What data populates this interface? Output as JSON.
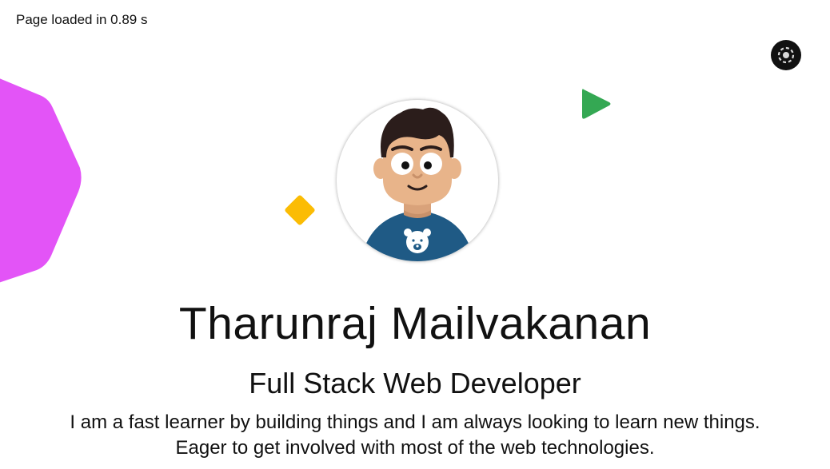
{
  "status": {
    "load_time_text": "Page loaded in 0.89 s"
  },
  "header": {
    "theme_toggle_icon": "theme-toggle-icon"
  },
  "profile": {
    "name": "Tharunraj Mailvakanan",
    "role": "Full Stack Web Developer",
    "bio_line_1": "I am a fast learner by building things and I am always looking to learn new things.",
    "bio_line_2": "Eager to get involved with most of the web technologies."
  },
  "colors": {
    "hexagon": "#e354f7",
    "triangle": "#34a853",
    "diamond": "#fbbc04",
    "shirt": "#1f5a85",
    "skin": "#e8b48a",
    "hair": "#2b1d1b"
  }
}
